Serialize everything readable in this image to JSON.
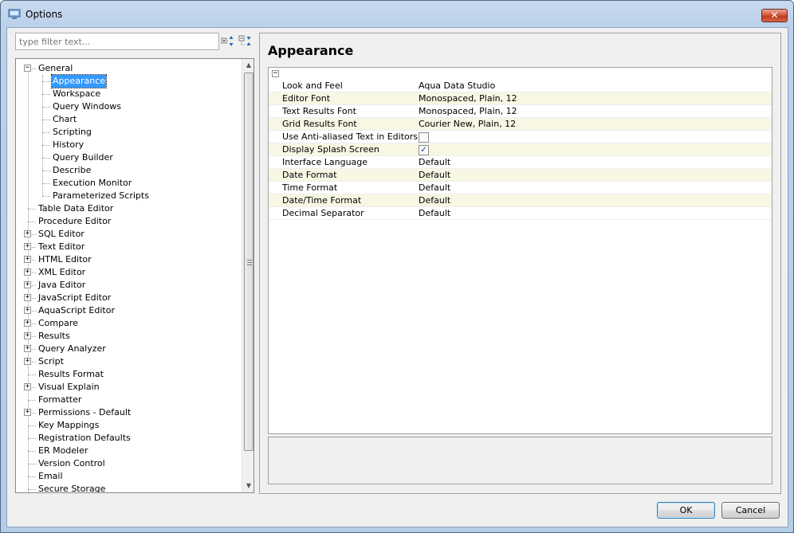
{
  "window": {
    "title": "Options",
    "close_label": "✕"
  },
  "filter": {
    "placeholder": "type filter text..."
  },
  "tree": {
    "items": [
      {
        "label": "General",
        "depth": 0,
        "expander": "-"
      },
      {
        "label": "Appearance",
        "depth": 1,
        "selected": true
      },
      {
        "label": "Workspace",
        "depth": 1
      },
      {
        "label": "Query Windows",
        "depth": 1
      },
      {
        "label": "Chart",
        "depth": 1
      },
      {
        "label": "Scripting",
        "depth": 1
      },
      {
        "label": "History",
        "depth": 1
      },
      {
        "label": "Query Builder",
        "depth": 1
      },
      {
        "label": "Describe",
        "depth": 1
      },
      {
        "label": "Execution Monitor",
        "depth": 1
      },
      {
        "label": "Parameterized Scripts",
        "depth": 1
      },
      {
        "label": "Table Data Editor",
        "depth": 0
      },
      {
        "label": "Procedure Editor",
        "depth": 0
      },
      {
        "label": "SQL Editor",
        "depth": 0,
        "expander": "+"
      },
      {
        "label": "Text Editor",
        "depth": 0,
        "expander": "+"
      },
      {
        "label": "HTML Editor",
        "depth": 0,
        "expander": "+"
      },
      {
        "label": "XML Editor",
        "depth": 0,
        "expander": "+"
      },
      {
        "label": "Java Editor",
        "depth": 0,
        "expander": "+"
      },
      {
        "label": "JavaScript Editor",
        "depth": 0,
        "expander": "+"
      },
      {
        "label": "AquaScript Editor",
        "depth": 0,
        "expander": "+"
      },
      {
        "label": "Compare",
        "depth": 0,
        "expander": "+"
      },
      {
        "label": "Results",
        "depth": 0,
        "expander": "+"
      },
      {
        "label": "Query Analyzer",
        "depth": 0,
        "expander": "+"
      },
      {
        "label": "Script",
        "depth": 0,
        "expander": "+"
      },
      {
        "label": "Results Format",
        "depth": 0
      },
      {
        "label": "Visual Explain",
        "depth": 0,
        "expander": "+"
      },
      {
        "label": "Formatter",
        "depth": 0
      },
      {
        "label": "Permissions - Default",
        "depth": 0,
        "expander": "+"
      },
      {
        "label": "Key Mappings",
        "depth": 0
      },
      {
        "label": "Registration Defaults",
        "depth": 0
      },
      {
        "label": "ER Modeler",
        "depth": 0
      },
      {
        "label": "Version Control",
        "depth": 0
      },
      {
        "label": "Email",
        "depth": 0
      },
      {
        "label": "Secure Storage",
        "depth": 0
      }
    ]
  },
  "page": {
    "title": "Appearance",
    "collapse_symbol": "−",
    "properties": [
      {
        "name": "Look and Feel",
        "value": "Aqua Data Studio"
      },
      {
        "name": "Editor Font",
        "value": "Monospaced, Plain, 12"
      },
      {
        "name": "Text Results Font",
        "value": "Monospaced, Plain, 12"
      },
      {
        "name": "Grid Results Font",
        "value": "Courier New, Plain, 12"
      },
      {
        "name": "Use Anti-aliased Text in Editors",
        "checkbox": true,
        "checked": false
      },
      {
        "name": "Display Splash Screen",
        "checkbox": true,
        "checked": true
      },
      {
        "name": "Interface Language",
        "value": "Default"
      },
      {
        "name": "Date Format",
        "value": "Default"
      },
      {
        "name": "Time Format",
        "value": "Default"
      },
      {
        "name": "Date/Time Format",
        "value": "Default"
      },
      {
        "name": "Decimal Separator",
        "value": "Default"
      }
    ]
  },
  "buttons": {
    "ok": "OK",
    "cancel": "Cancel"
  },
  "icons": {
    "app": "options-window-icon",
    "expand_all": "expand-all-icon",
    "collapse_all": "collapse-all-icon"
  }
}
